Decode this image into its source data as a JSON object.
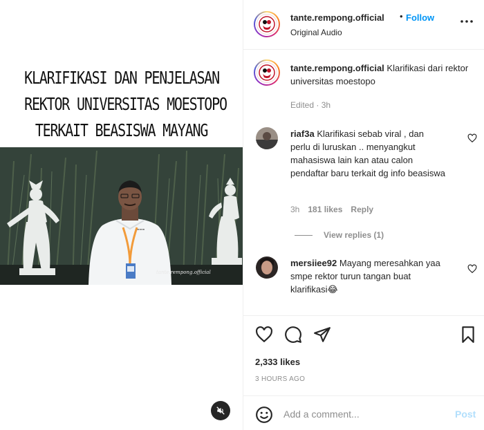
{
  "media": {
    "title_lines": [
      "KLARIFIKASI DAN PENJELASAN",
      "REKTOR UNIVERSITAS MOESTOPO",
      "TERKAIT BEASISWA MAYANG"
    ],
    "watermark": "tante.rempong.official",
    "mute_icon": "speaker-muted-icon"
  },
  "header": {
    "username": "tante.rempong.official",
    "separator": "•",
    "follow_label": "Follow",
    "subtitle": "Original Audio"
  },
  "caption": {
    "username": "tante.rempong.official",
    "text": "Klarifikasi dari rektor universitas moestopo",
    "meta": "Edited · 3h"
  },
  "comments": [
    {
      "username": "riaf3a",
      "text": "Klarifikasi sebab viral , dan perlu di luruskan .. menyangkut mahasiswa lain kan atau calon pendaftar baru terkait dg info beasiswa",
      "time": "3h",
      "likes": "181 likes",
      "reply_label": "Reply",
      "view_replies": "View replies (1)"
    },
    {
      "username": "mersiiee92",
      "text": "Mayang meresahkan yaa smpe rektor turun tangan buat klarifikasi😂"
    }
  ],
  "actions": {
    "likes": "2,333 likes",
    "time": "3 HOURS AGO"
  },
  "add_comment": {
    "placeholder": "Add a comment...",
    "post_label": "Post"
  },
  "colors": {
    "accent": "#0095f6",
    "post_disabled": "#b2dffc",
    "muted_text": "#8e8e8e",
    "border": "#efefef"
  }
}
